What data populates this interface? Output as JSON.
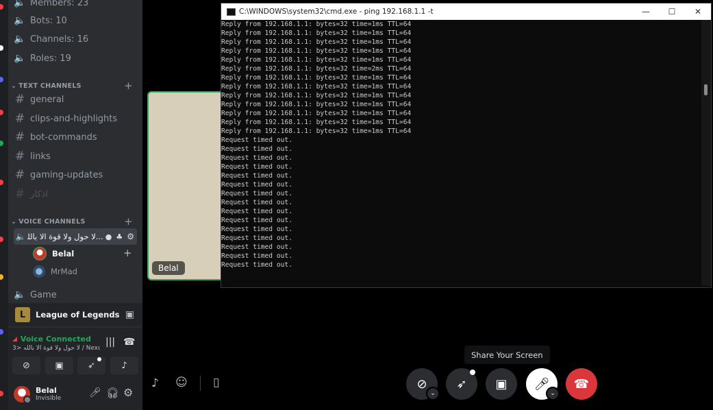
{
  "server_stats": {
    "members": "Members: 23",
    "bots": "Bots: 10",
    "channels": "Channels: 16",
    "roles": "Roles: 19"
  },
  "text_category": "TEXT CHANNELS",
  "text_channels": [
    "general",
    "clips-and-highlights",
    "bot-commands",
    "links",
    "gaming-updates",
    "اذكار"
  ],
  "voice_category": "VOICE CHANNELS",
  "active_voice_channel": "...لا حول ولا قوة الا بالله <3",
  "voice_users": [
    "Belal",
    "MrMad"
  ],
  "game_channel": "Game",
  "activity": {
    "name": "League of Legends"
  },
  "voice_connected": {
    "status": "Voice Connected",
    "channel": "3> لا حول ولا قوة الا بالله / Nexus..."
  },
  "user": {
    "name": "Belal",
    "status": "Invisible"
  },
  "stage_tile": {
    "label": "Belal"
  },
  "cmd": {
    "title": "C:\\WINDOWS\\system32\\cmd.exe - ping  192.168.1.1 -t",
    "lines": [
      "Reply from 192.168.1.1: bytes=32 time=1ms TTL=64",
      "Reply from 192.168.1.1: bytes=32 time=1ms TTL=64",
      "Reply from 192.168.1.1: bytes=32 time=1ms TTL=64",
      "Reply from 192.168.1.1: bytes=32 time=1ms TTL=64",
      "Reply from 192.168.1.1: bytes=32 time=1ms TTL=64",
      "Reply from 192.168.1.1: bytes=32 time=2ms TTL=64",
      "Reply from 192.168.1.1: bytes=32 time=1ms TTL=64",
      "Reply from 192.168.1.1: bytes=32 time=1ms TTL=64",
      "Reply from 192.168.1.1: bytes=32 time=1ms TTL=64",
      "Reply from 192.168.1.1: bytes=32 time=1ms TTL=64",
      "Reply from 192.168.1.1: bytes=32 time=1ms TTL=64",
      "Reply from 192.168.1.1: bytes=32 time=1ms TTL=64",
      "Reply from 192.168.1.1: bytes=32 time=1ms TTL=64",
      "Request timed out.",
      "Request timed out.",
      "Request timed out.",
      "Request timed out.",
      "Request timed out.",
      "Request timed out.",
      "Request timed out.",
      "Request timed out.",
      "Request timed out.",
      "Request timed out.",
      "Request timed out.",
      "Request timed out.",
      "Request timed out.",
      "Request timed out.",
      "Request timed out."
    ]
  },
  "tooltip": "Share Your Screen",
  "colors": {
    "voice_green": "#3ba55c",
    "disconnect_red": "#da373c",
    "sidebar_bg": "#2b2d31"
  }
}
